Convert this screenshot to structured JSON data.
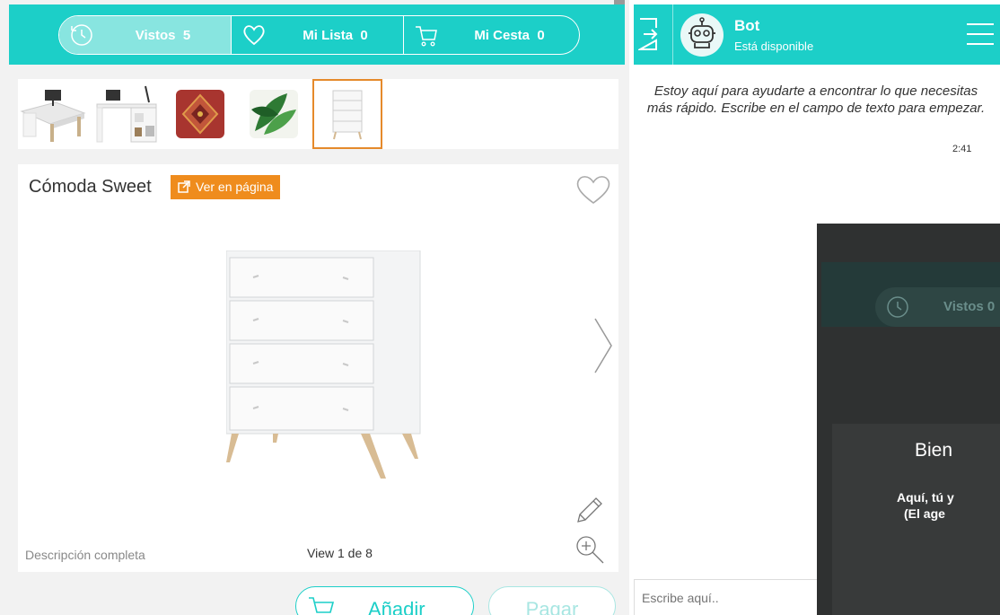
{
  "nav": {
    "tabs": [
      {
        "label": "Vistos",
        "count": "5",
        "icon": "history-icon"
      },
      {
        "label": "Mi Lista",
        "count": "0",
        "icon": "heart-icon"
      },
      {
        "label": "Mi Cesta",
        "count": "0",
        "icon": "cart-icon"
      }
    ]
  },
  "thumbnails": [
    {
      "name": "corner-desk-oak"
    },
    {
      "name": "white-desk-shelves"
    },
    {
      "name": "red-pattern-cushion"
    },
    {
      "name": "green-leaf-cushion"
    },
    {
      "name": "white-dresser",
      "selected": true
    }
  ],
  "product": {
    "title": "Cómoda Sweet",
    "view_page_label": "Ver en página",
    "description_link": "Descripción completa",
    "view_counter": "View 1 de 8"
  },
  "actions": {
    "add_label": "Añadir",
    "pay_label": "Pagar"
  },
  "chat": {
    "bot_name": "Bot",
    "bot_status": "Está disponible",
    "message": "Estoy aquí para ayudarte a encontrar lo que necesitas más rápido. Escribe en el campo de texto para empezar.",
    "message_time": "2:41",
    "input_placeholder": "Escribe aquí.."
  },
  "overlay": {
    "tab_label": "Vistos 0",
    "title": "Bien",
    "line1": "Aquí, tú y",
    "line2": "(El age"
  },
  "colors": {
    "brand": "#1ccfc8",
    "accent": "#ef8c1d"
  }
}
